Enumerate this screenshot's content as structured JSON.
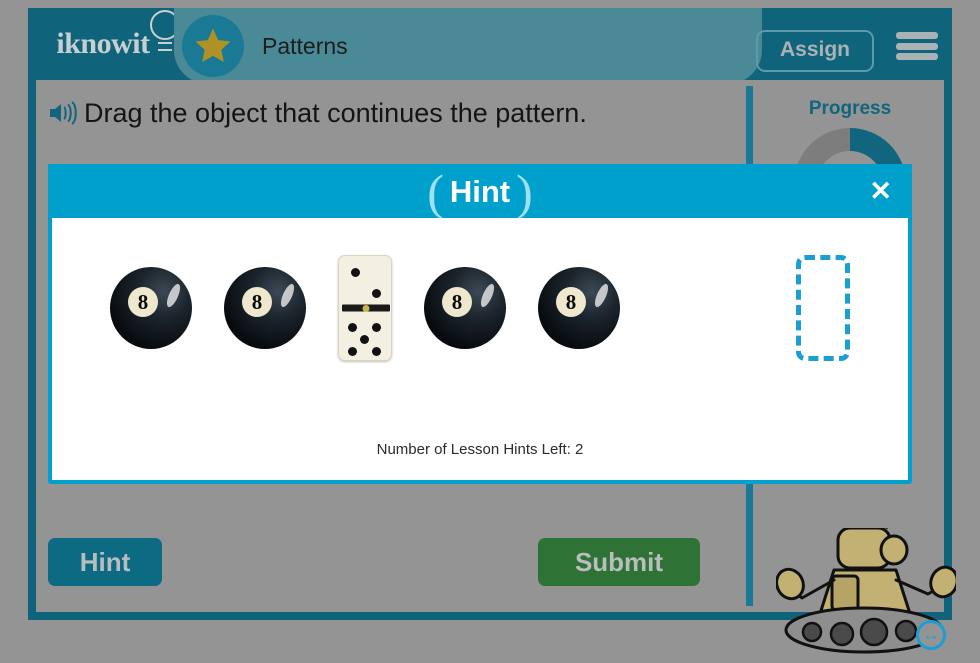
{
  "header": {
    "logo_text": "iknowit",
    "logo_icon": "lightbulb-icon",
    "star_icon": "star-icon",
    "lesson_title": "Patterns",
    "assign_label": "Assign",
    "menu_icon": "hamburger-menu-icon"
  },
  "question": {
    "audio_icon": "speaker-icon",
    "text": "Drag the object that continues the pattern."
  },
  "progress": {
    "label": "Progress",
    "percent": 50
  },
  "mascot": {
    "name": "robot-mascot",
    "resize_icon": "resize-horizontal-icon",
    "resize_glyph": "↔"
  },
  "actions": {
    "hint_label": "Hint",
    "submit_label": "Submit"
  },
  "modal": {
    "title": "Hint",
    "left_paren": "(",
    "right_paren": ")",
    "close_glyph": "✕",
    "hints_left_text": "Number of Lesson Hints Left: 2",
    "pattern": [
      {
        "kind": "eight-ball",
        "label": "8"
      },
      {
        "kind": "eight-ball",
        "label": "8"
      },
      {
        "kind": "domino",
        "top_pips": 2,
        "bottom_pips": 5
      },
      {
        "kind": "eight-ball",
        "label": "8"
      },
      {
        "kind": "eight-ball",
        "label": "8"
      },
      {
        "kind": "drop-zone",
        "label": ""
      }
    ]
  },
  "colors": {
    "page_bg": "#949494",
    "frame_teal": "#0f647b",
    "tab_teal": "#4a8a96",
    "modal_cyan": "#00a0cd",
    "submit_green": "#2e7236",
    "hint_teal": "#0d6a83",
    "star_gold": "#b09126",
    "dropzone_blue": "#1a9fd4"
  }
}
